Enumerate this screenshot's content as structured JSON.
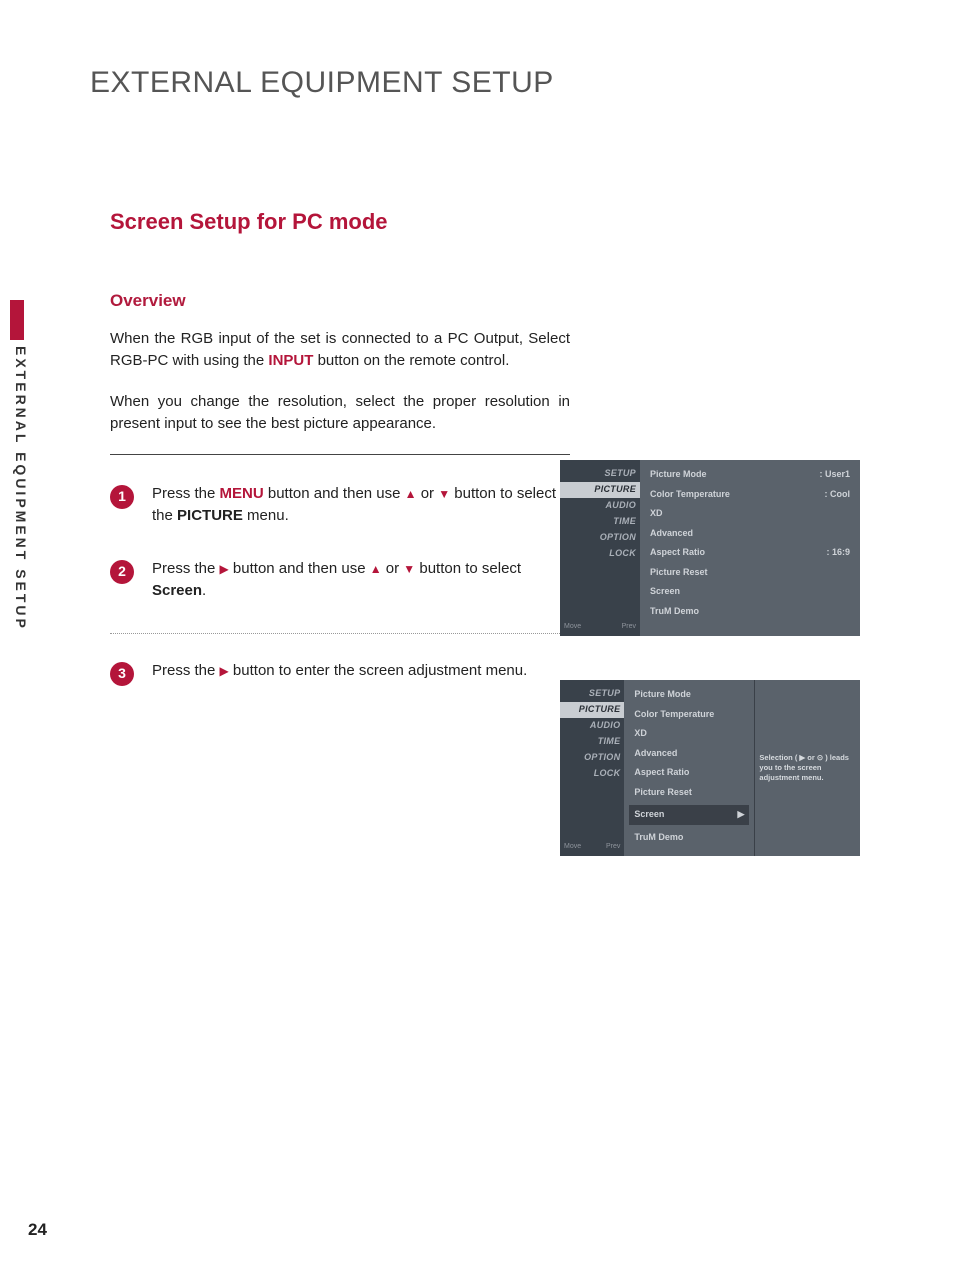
{
  "page_number": "24",
  "side_tab": "EXTERNAL EQUIPMENT SETUP",
  "title": "EXTERNAL EQUIPMENT SETUP",
  "section_title": "Screen Setup for PC mode",
  "overview_heading": "Overview",
  "overview_p1_a": "When the RGB input of the set is connected to a PC Output, Select RGB-PC with using the ",
  "overview_p1_kw": "INPUT",
  "overview_p1_b": " button on the remote control.",
  "overview_p2": "When you change the resolution, select the proper resolution in present input to see the best picture appearance.",
  "steps": [
    {
      "num": "1",
      "pre": "Press the ",
      "kw_red": "MENU",
      "mid": " button and then use ",
      "post": " button to select the ",
      "kw_bold": "PICTURE",
      "tail": " menu."
    },
    {
      "num": "2",
      "pre": "Press the ",
      "mid": " button and then use ",
      "post": " button to select ",
      "kw_bold": "Screen",
      "tail": "."
    },
    {
      "num": "3",
      "pre": "Press the ",
      "post": " button to enter the screen adjustment menu."
    }
  ],
  "osd_nav": [
    "SETUP",
    "PICTURE",
    "AUDIO",
    "TIME",
    "OPTION",
    "LOCK"
  ],
  "osd_nav_footer": {
    "move": "Move",
    "prev": "Prev"
  },
  "osd1_items": [
    {
      "label": "Picture Mode",
      "value": ": User1"
    },
    {
      "label": "Color Temperature",
      "value": ": Cool"
    },
    {
      "label": "XD",
      "value": ""
    },
    {
      "label": "Advanced",
      "value": ""
    },
    {
      "label": "Aspect Ratio",
      "value": ": 16:9"
    },
    {
      "label": "Picture Reset",
      "value": ""
    },
    {
      "label": "Screen",
      "value": ""
    },
    {
      "label": "TruM Demo",
      "value": ""
    }
  ],
  "osd2_items": [
    {
      "label": "Picture Mode",
      "value": ""
    },
    {
      "label": "Color Temperature",
      "value": ""
    },
    {
      "label": "XD",
      "value": ""
    },
    {
      "label": "Advanced",
      "value": ""
    },
    {
      "label": "Aspect Ratio",
      "value": ""
    },
    {
      "label": "Picture Reset",
      "value": ""
    },
    {
      "label": "Screen",
      "value": "",
      "selected": true,
      "arrow": "▶"
    },
    {
      "label": "TruM Demo",
      "value": ""
    }
  ],
  "osd2_hint": "Selection ( ▶ or ⊙ ) leads you to the screen adjustment menu."
}
